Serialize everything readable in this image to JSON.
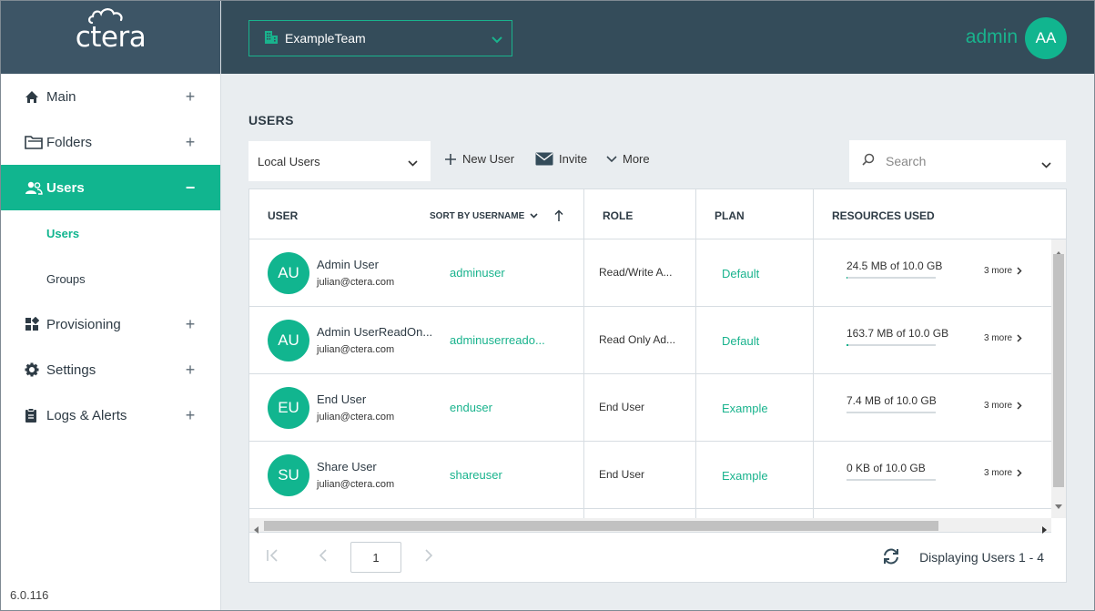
{
  "sidebar": {
    "logo_text": "ctera",
    "items": [
      {
        "label": "Main",
        "toggle": "+"
      },
      {
        "label": "Folders",
        "toggle": "+"
      },
      {
        "label": "Users",
        "toggle": "−"
      },
      {
        "label": "Provisioning",
        "toggle": "+"
      },
      {
        "label": "Settings",
        "toggle": "+"
      },
      {
        "label": "Logs & Alerts",
        "toggle": "+"
      }
    ],
    "subitems": [
      {
        "label": "Users"
      },
      {
        "label": "Groups"
      }
    ],
    "version": "6.0.116"
  },
  "header": {
    "team": "ExampleTeam",
    "user_name": "admin",
    "user_initials": "AA"
  },
  "page": {
    "title": "USERS",
    "filter": "Local Users",
    "new_user": "New User",
    "invite": "Invite",
    "more": "More",
    "search_placeholder": "Search"
  },
  "table": {
    "headers": {
      "user": "USER",
      "sort": "SORT BY USERNAME",
      "role": "ROLE",
      "plan": "PLAN",
      "resources": "RESOURCES USED"
    },
    "rows": [
      {
        "initials": "AU",
        "name": "Admin User",
        "email": "julian@ctera.com",
        "username": "adminuser",
        "role": "Read/Write A...",
        "plan": "Default",
        "resources": "24.5 MB of 10.0 GB",
        "usage": 0.0024,
        "more": "3 more"
      },
      {
        "initials": "AU",
        "name": "Admin UserReadOn...",
        "email": "julian@ctera.com",
        "username": "adminuserreado...",
        "role": "Read Only Ad...",
        "plan": "Default",
        "resources": "163.7 MB of 10.0 GB",
        "usage": 0.016,
        "more": "3 more"
      },
      {
        "initials": "EU",
        "name": "End User",
        "email": "julian@ctera.com",
        "username": "enduser",
        "role": "End User",
        "plan": "Example",
        "resources": "7.4 MB of 10.0 GB",
        "usage": 0.0007,
        "more": "3 more"
      },
      {
        "initials": "SU",
        "name": "Share User",
        "email": "julian@ctera.com",
        "username": "shareuser",
        "role": "End User",
        "plan": "Example",
        "resources": "0 KB of 10.0 GB",
        "usage": 0,
        "more": "3 more"
      }
    ]
  },
  "pager": {
    "page": "1",
    "display_text": "Displaying Users 1 - 4"
  },
  "colors": {
    "accent": "#11b58f",
    "header_bg": "#344c5a",
    "logo_bg": "#3d5566"
  }
}
